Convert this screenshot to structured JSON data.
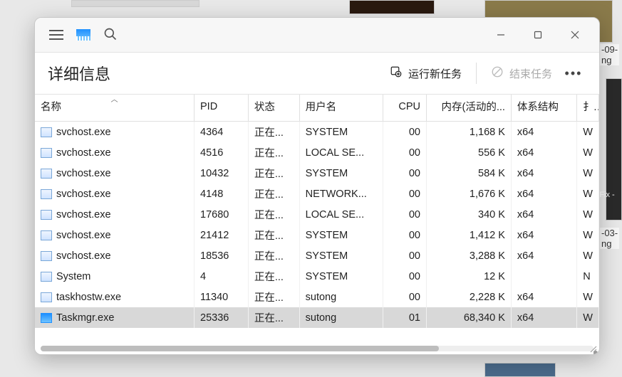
{
  "bg": {
    "label1": "-09-",
    "label1b": "ng",
    "label2": "-03-",
    "label2b": "ng",
    "sfix": "SFix -"
  },
  "toolbar": {
    "title": "详细信息",
    "run_label": "运行新任务",
    "end_label": "结束任务"
  },
  "columns": {
    "name": "名称",
    "pid": "PID",
    "status": "状态",
    "user": "用户名",
    "cpu": "CPU",
    "mem": "内存(活动的...",
    "arch": "体系结构",
    "extra": "扌"
  },
  "rows": [
    {
      "name": "svchost.exe",
      "pid": "4364",
      "status": "正在...",
      "user": "SYSTEM",
      "cpu": "00",
      "mem": "1,168 K",
      "arch": "x64",
      "extra": "W",
      "icon": "svc"
    },
    {
      "name": "svchost.exe",
      "pid": "4516",
      "status": "正在...",
      "user": "LOCAL SE...",
      "cpu": "00",
      "mem": "556 K",
      "arch": "x64",
      "extra": "W",
      "icon": "svc"
    },
    {
      "name": "svchost.exe",
      "pid": "10432",
      "status": "正在...",
      "user": "SYSTEM",
      "cpu": "00",
      "mem": "584 K",
      "arch": "x64",
      "extra": "W",
      "icon": "svc"
    },
    {
      "name": "svchost.exe",
      "pid": "4148",
      "status": "正在...",
      "user": "NETWORK...",
      "cpu": "00",
      "mem": "1,676 K",
      "arch": "x64",
      "extra": "W",
      "icon": "svc"
    },
    {
      "name": "svchost.exe",
      "pid": "17680",
      "status": "正在...",
      "user": "LOCAL SE...",
      "cpu": "00",
      "mem": "340 K",
      "arch": "x64",
      "extra": "W",
      "icon": "svc"
    },
    {
      "name": "svchost.exe",
      "pid": "21412",
      "status": "正在...",
      "user": "SYSTEM",
      "cpu": "00",
      "mem": "1,412 K",
      "arch": "x64",
      "extra": "W",
      "icon": "svc"
    },
    {
      "name": "svchost.exe",
      "pid": "18536",
      "status": "正在...",
      "user": "SYSTEM",
      "cpu": "00",
      "mem": "3,288 K",
      "arch": "x64",
      "extra": "W",
      "icon": "svc"
    },
    {
      "name": "System",
      "pid": "4",
      "status": "正在...",
      "user": "SYSTEM",
      "cpu": "00",
      "mem": "12 K",
      "arch": "",
      "extra": "N",
      "icon": "svc"
    },
    {
      "name": "taskhostw.exe",
      "pid": "11340",
      "status": "正在...",
      "user": "sutong",
      "cpu": "00",
      "mem": "2,228 K",
      "arch": "x64",
      "extra": "W",
      "icon": "svc"
    },
    {
      "name": "Taskmgr.exe",
      "pid": "25336",
      "status": "正在...",
      "user": "sutong",
      "cpu": "01",
      "mem": "68,340 K",
      "arch": "x64",
      "extra": "W",
      "icon": "tm",
      "selected": true
    }
  ]
}
